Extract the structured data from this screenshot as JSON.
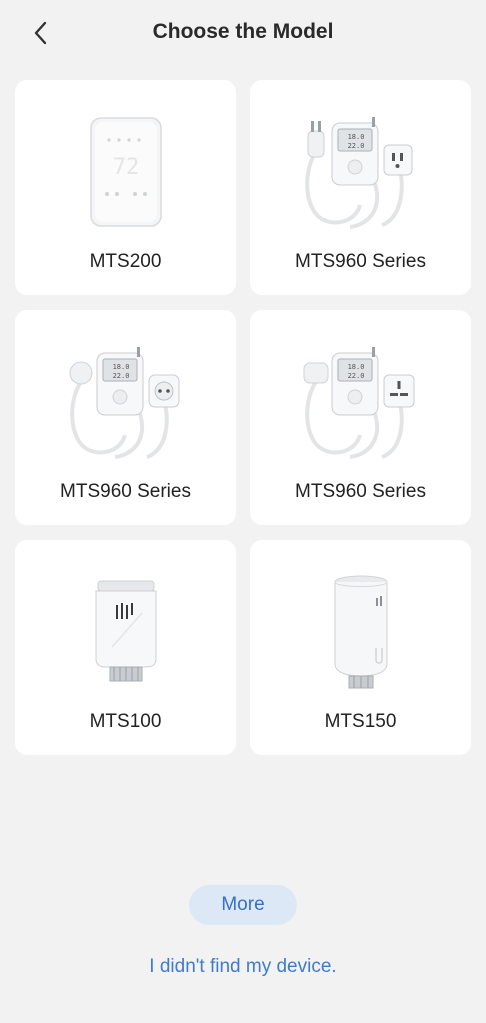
{
  "header": {
    "title": "Choose the Model",
    "back_icon": "chevron-left-icon"
  },
  "models": [
    {
      "label": "MTS200",
      "image": "wall-thermostat"
    },
    {
      "label": "MTS960 Series",
      "image": "plug-thermostat-us"
    },
    {
      "label": "MTS960 Series",
      "image": "plug-thermostat-eu"
    },
    {
      "label": "MTS960 Series",
      "image": "plug-thermostat-uk"
    },
    {
      "label": "MTS100",
      "image": "radiator-valve"
    },
    {
      "label": "MTS150",
      "image": "radiator-valve-round"
    }
  ],
  "footer": {
    "more_label": "More",
    "not_found_label": "I didn't find my device."
  },
  "colors": {
    "background": "#f2f2f2",
    "card": "#ffffff",
    "accent": "#3670c4",
    "accent_light": "#dde8f6"
  }
}
